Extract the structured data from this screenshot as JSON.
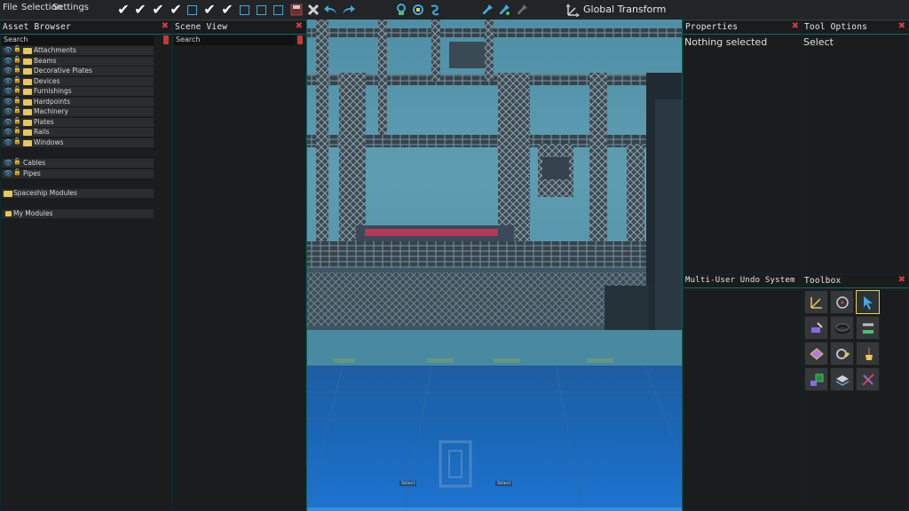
{
  "toolbar": {
    "menus": [
      "File",
      "Selection",
      "Settings"
    ],
    "checks": [
      "check",
      "check",
      "check",
      "check",
      "box",
      "check",
      "check",
      "box",
      "box",
      "box"
    ],
    "global_transform_label": "Global Transform"
  },
  "asset_browser": {
    "title": "Asset Browser",
    "search_placeholder": "Search",
    "folders": [
      "Attachments",
      "Beams",
      "Decorative Plates",
      "Devices",
      "Furnishings",
      "Hardpoints",
      "Machinery",
      "Plates",
      "Rails",
      "Windows"
    ],
    "extra_items": [
      "Cables",
      "Pipes"
    ],
    "groups": [
      "Spaceship Modules",
      "My Modules"
    ]
  },
  "scene_view": {
    "title": "Scene View",
    "search_placeholder": "Search"
  },
  "properties": {
    "title": "Properties",
    "body": "Nothing selected"
  },
  "tool_options": {
    "title": "Tool Options",
    "body": "Select"
  },
  "undo_system": {
    "title": "Multi-User Undo System"
  },
  "toolbox": {
    "title": "Toolbox"
  },
  "viewport": {
    "labels": [
      "Select",
      "Select"
    ]
  },
  "colors": {
    "accent": "#3fa9e0",
    "close": "#d23c3c",
    "folder": "#e8c85a",
    "selected_tool": "#e8d54a"
  }
}
